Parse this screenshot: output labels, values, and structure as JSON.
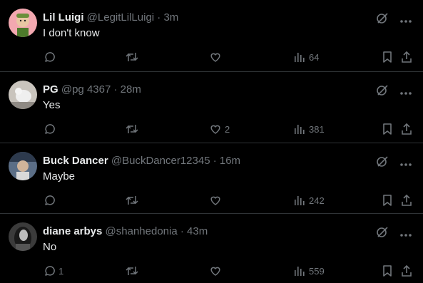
{
  "posts": [
    {
      "name": "Lil Luigi",
      "handle": "@LegitLilLuigi",
      "time": "3m",
      "text": "I don't know",
      "replies": "",
      "likes": "",
      "views": "64",
      "avatar_color": "#f3a8b0"
    },
    {
      "name": "PG",
      "handle": "@pg 4367",
      "time": "28m",
      "text": "Yes",
      "replies": "",
      "likes": "2",
      "views": "381",
      "avatar_color": "#c9c4bd"
    },
    {
      "name": "Buck Dancer",
      "handle": "@BuckDancer12345",
      "time": "16m",
      "text": "Maybe",
      "replies": "",
      "likes": "",
      "views": "242",
      "avatar_color": "#5b6e86"
    },
    {
      "name": "diane arbys",
      "handle": "@shanhedonia",
      "time": "43m",
      "text": "No",
      "replies": "1",
      "likes": "",
      "views": "559",
      "avatar_color": "#3b3b3b"
    }
  ],
  "separator": "·",
  "colors": {
    "background": "#000000",
    "text": "#e7e9ea",
    "muted": "#71767b",
    "divider": "#2f3336"
  }
}
